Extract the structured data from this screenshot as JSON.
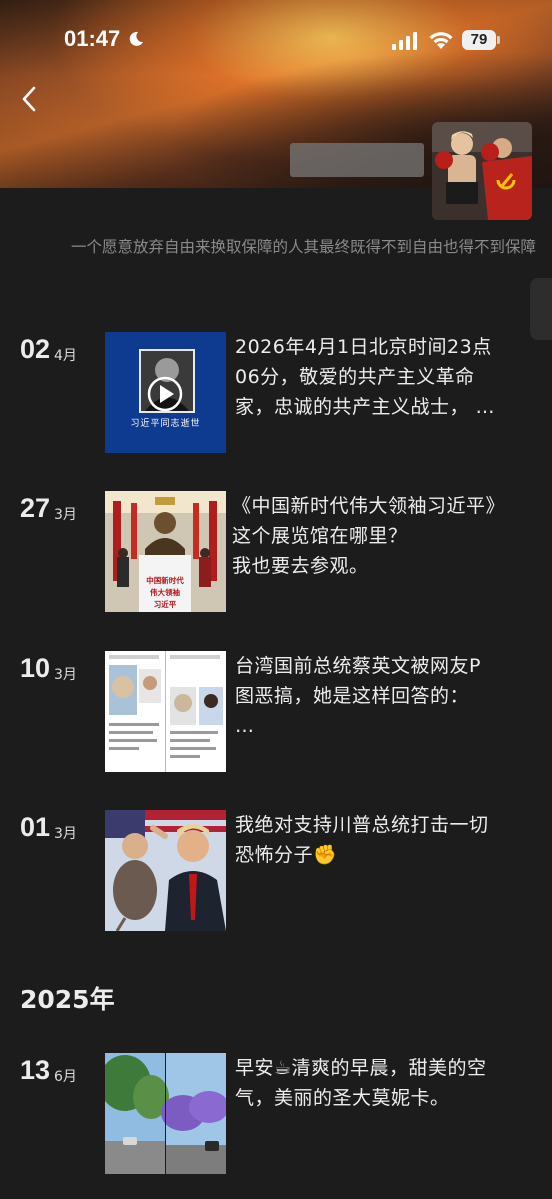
{
  "status_bar": {
    "time": "01:47",
    "battery": "79"
  },
  "profile": {
    "signature": "一个愿意放弃自由来换取保障的人其最终既得不到自由也得不到保障"
  },
  "posts_2026": [
    {
      "day": "02",
      "month": "4月",
      "thumb_caption": "习近平同志逝世",
      "text_lines": [
        "2026年4月1日北京时间23点",
        "06分，敬爱的共产主义革命",
        "家，忠诚的共产主义战士，  …"
      ]
    },
    {
      "day": "27",
      "month": "3月",
      "thumb_caption_lines": [
        "中国新时代",
        "伟大领袖",
        "习近平"
      ],
      "text_lines": [
        "《中国新时代伟大领袖习近平》",
        "这个展览馆在哪里？",
        "我也要去参观。"
      ]
    },
    {
      "day": "10",
      "month": "3月",
      "text_lines": [
        "台湾国前总统蔡英文被网友P",
        "图恶搞，她是这样回答的：",
        "…"
      ]
    },
    {
      "day": "01",
      "month": "3月",
      "text_lines": [
        "我绝对支持川普总统打击一切",
        "恐怖分子✊"
      ]
    }
  ],
  "year_header": "2025年",
  "posts_2025": [
    {
      "day": "13",
      "month": "6月",
      "text_lines": [
        "早安☕清爽的早晨，甜美的空",
        "气，美丽的圣大莫妮卡。"
      ]
    }
  ]
}
